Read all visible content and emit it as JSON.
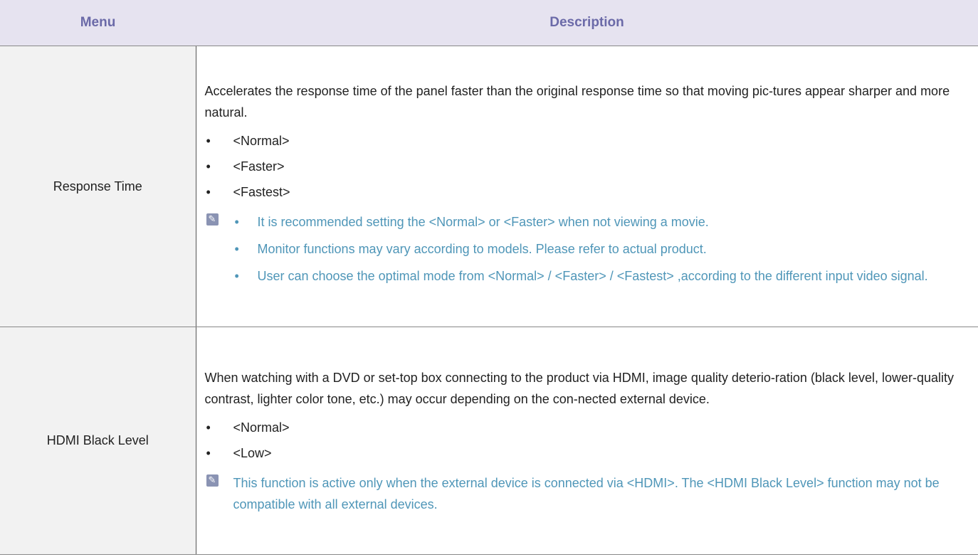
{
  "header": {
    "menu": "Menu",
    "description": "Description"
  },
  "rows": [
    {
      "menu": "Response Time",
      "intro": "Accelerates the response time of the panel faster than the original response time so that moving pic-tures appear sharper and more natural.",
      "options": [
        "<Normal>",
        "<Faster>",
        "<Fastest>"
      ],
      "notes": [
        "It is recommended setting the <Normal> or <Faster> when not viewing a movie.",
        "Monitor functions may vary according to models. Please refer to actual product.",
        "User can choose the optimal mode from <Normal> / <Faster> / <Fastest> ,according to the different input video signal."
      ]
    },
    {
      "menu": "HDMI Black Level",
      "intro": "When watching with a DVD or set-top box connecting to the product via HDMI, image quality deterio-ration (black level, lower-quality contrast, lighter color tone, etc.) may occur depending on the con-nected external device.",
      "options": [
        "<Normal>",
        "<Low>"
      ],
      "note": "This function is active only when the external device is connected via <HDMI>. The <HDMI Black Level> function may not be compatible with all external devices."
    }
  ],
  "icons": {
    "bullet": "•",
    "note": "note-pencil-icon"
  },
  "colors": {
    "header_bg": "#e6e3f0",
    "header_text": "#6b6aa8",
    "note_text": "#4f96b8",
    "menu_bg": "#f2f2f2"
  }
}
